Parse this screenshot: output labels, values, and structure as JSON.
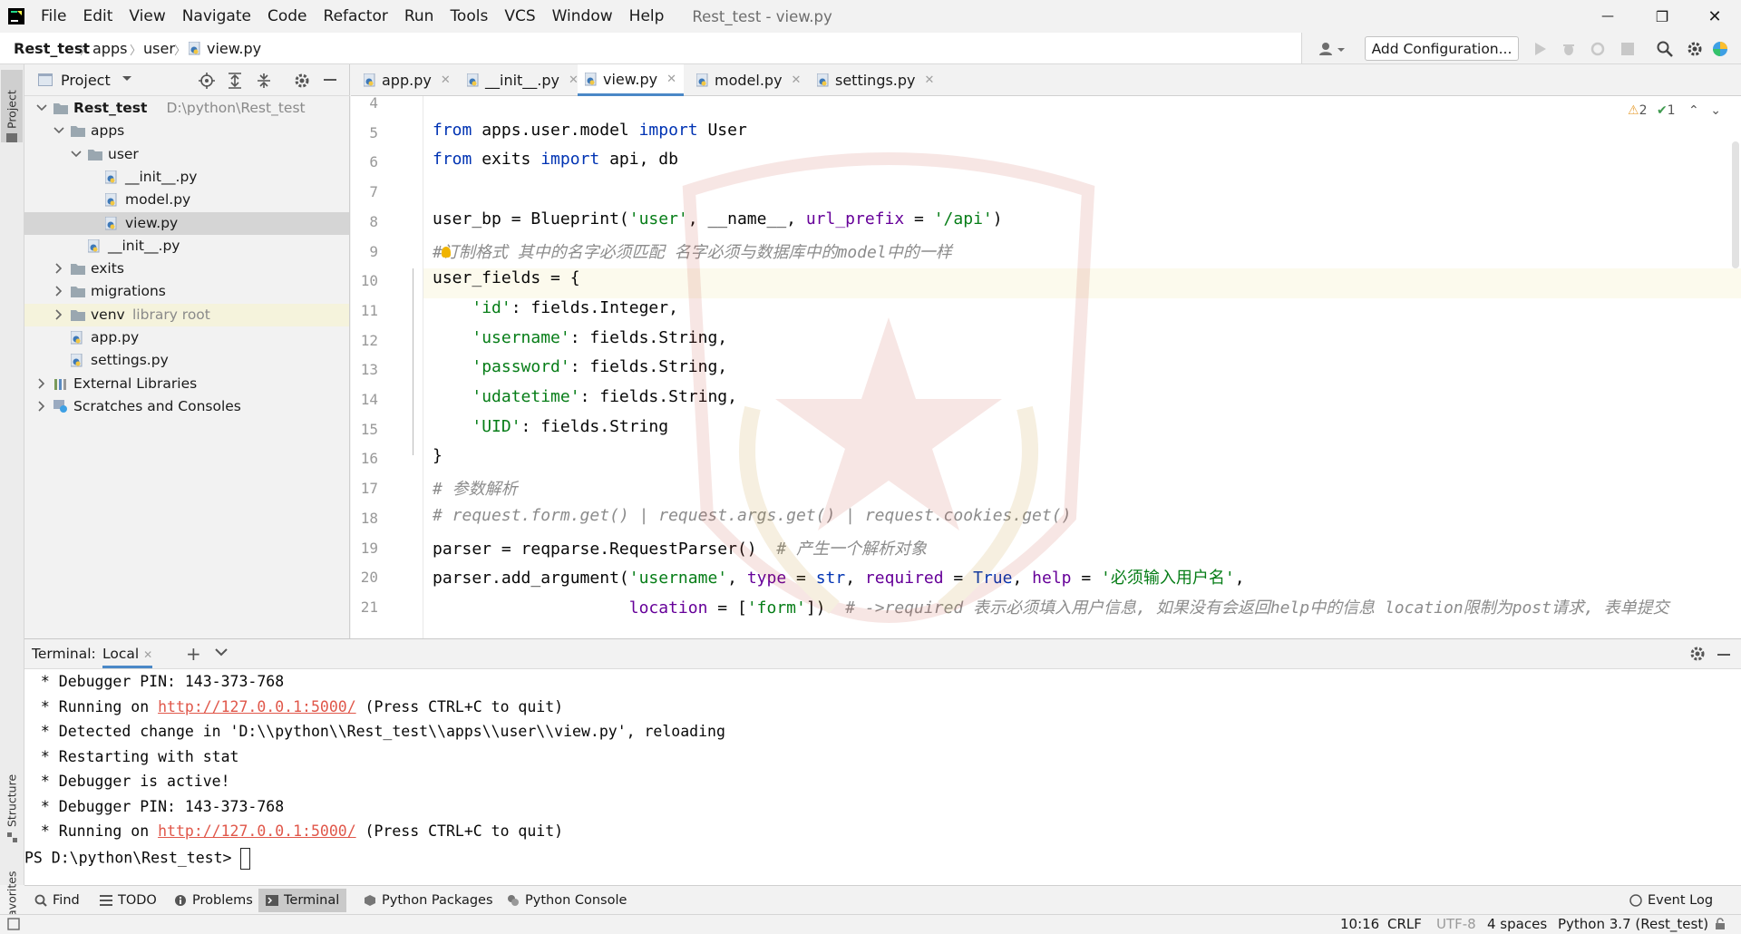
{
  "window": {
    "title": "Rest_test - view.py",
    "menus": [
      "File",
      "Edit",
      "View",
      "Navigate",
      "Code",
      "Refactor",
      "Run",
      "Tools",
      "VCS",
      "Window",
      "Help"
    ],
    "controls": {
      "minimize": "—",
      "maximize": "❐",
      "close": "✕"
    }
  },
  "breadcrumb": {
    "project": "Rest_test",
    "items": [
      "apps",
      "user",
      "view.py"
    ]
  },
  "run": {
    "add_configuration": "Add Configuration..."
  },
  "project_panel": {
    "title": "Project",
    "tree": [
      {
        "label": "Rest_test",
        "hint": "D:\\python\\Rest_test",
        "type": "folder",
        "expanded": true
      },
      {
        "label": "apps",
        "type": "folder",
        "expanded": true
      },
      {
        "label": "user",
        "type": "folder",
        "expanded": true
      },
      {
        "label": "__init__.py",
        "type": "py"
      },
      {
        "label": "model.py",
        "type": "py"
      },
      {
        "label": "view.py",
        "type": "py",
        "selected": true
      },
      {
        "label": "__init__.py",
        "type": "py"
      },
      {
        "label": "exits",
        "type": "folder",
        "expanded": false
      },
      {
        "label": "migrations",
        "type": "folder",
        "expanded": false
      },
      {
        "label": "venv",
        "hint": "library root",
        "type": "folder",
        "expanded": false
      },
      {
        "label": "app.py",
        "type": "py"
      },
      {
        "label": "settings.py",
        "type": "py"
      },
      {
        "label": "External Libraries",
        "type": "lib",
        "expanded": false
      },
      {
        "label": "Scratches and Consoles",
        "type": "scratch",
        "expanded": false
      }
    ]
  },
  "left_strip": {
    "project": "Project",
    "structure": "Structure",
    "favorites": "Favorites"
  },
  "editor": {
    "tabs": [
      "app.py",
      "__init__.py",
      "view.py",
      "model.py",
      "settings.py"
    ],
    "active_tab": "view.py",
    "inspections": {
      "warnings": "2",
      "ok": "1"
    },
    "lines": [
      {
        "n": "4",
        "t": ""
      },
      {
        "n": "5",
        "t": "from apps.user.model import User"
      },
      {
        "n": "6",
        "t": "from exits import api, db"
      },
      {
        "n": "7",
        "t": ""
      },
      {
        "n": "8",
        "t": "user_bp = Blueprint('user', __name__, url_prefix = '/api')"
      },
      {
        "n": "9",
        "t": "#订制格式 其中的名字必须匹配 名字必须与数据库中的model中的一样"
      },
      {
        "n": "10",
        "t": "user_fields = {"
      },
      {
        "n": "11",
        "t": "    'id': fields.Integer,"
      },
      {
        "n": "12",
        "t": "    'username': fields.String,"
      },
      {
        "n": "13",
        "t": "    'password': fields.String,"
      },
      {
        "n": "14",
        "t": "    'udatetime': fields.String,"
      },
      {
        "n": "15",
        "t": "    'UID': fields.String"
      },
      {
        "n": "16",
        "t": "}"
      },
      {
        "n": "17",
        "t": "# 参数解析"
      },
      {
        "n": "18",
        "t": "# request.form.get() | request.args.get() | request.cookies.get()"
      },
      {
        "n": "19",
        "t": "parser = reqparse.RequestParser()  # 产生一个解析对象"
      },
      {
        "n": "20",
        "t": "parser.add_argument('username', type = str, required = True, help = '必须输入用户名',"
      },
      {
        "n": "21",
        "t": "                    location = ['form'])  # ->required 表示必须填入用户信息, 如果没有会返回help中的信息 location限制为post请求, 表单提交"
      }
    ]
  },
  "terminal": {
    "label": "Terminal:",
    "tab": "Local",
    "lines": [
      {
        "pre": " * Debugger PIN: 143-373-768"
      },
      {
        "pre": " * Running on ",
        "link": "http://127.0.0.1:5000/",
        "post": " (Press CTRL+C to quit)"
      },
      {
        "pre": " * Detected change in 'D:\\\\python\\\\Rest_test\\\\apps\\\\user\\\\view.py', reloading"
      },
      {
        "pre": " * Restarting with stat"
      },
      {
        "pre": " * Debugger is active!"
      },
      {
        "pre": " * Debugger PIN: 143-373-768"
      },
      {
        "pre": " * Running on ",
        "link": "http://127.0.0.1:5000/",
        "post": " (Press CTRL+C to quit)"
      }
    ],
    "prompt": "PS D:\\python\\Rest_test> "
  },
  "tool_windows": {
    "find": "Find",
    "todo": "TODO",
    "problems": "Problems",
    "terminal": "Terminal",
    "python_packages": "Python Packages",
    "python_console": "Python Console",
    "event_log": "Event Log"
  },
  "status": {
    "position": "10:16",
    "line_sep": "CRLF",
    "encoding": "UTF-8",
    "indent": "4 spaces",
    "interpreter": "Python 3.7 (Rest_test)"
  }
}
